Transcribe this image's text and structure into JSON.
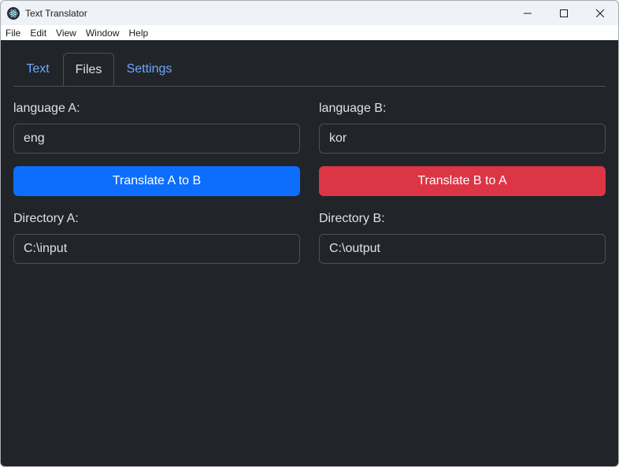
{
  "window": {
    "title": "Text Translator",
    "controls": {
      "minimize": "minimize-icon",
      "maximize": "maximize-icon",
      "close": "close-icon"
    }
  },
  "menu": {
    "items": [
      {
        "label": "File"
      },
      {
        "label": "Edit"
      },
      {
        "label": "View"
      },
      {
        "label": "Window"
      },
      {
        "label": "Help"
      }
    ]
  },
  "tabs": [
    {
      "label": "Text"
    },
    {
      "label": "Files",
      "active": true
    },
    {
      "label": "Settings"
    }
  ],
  "files": {
    "language_a_label": "language A:",
    "language_a_value": "eng",
    "language_b_label": "language B:",
    "language_b_value": "kor",
    "translate_a_to_b_label": "Translate A to B",
    "translate_b_to_a_label": "Translate B to A",
    "directory_a_label": "Directory A:",
    "directory_a_value": "C:\\input",
    "directory_b_label": "Directory B:",
    "directory_b_value": "C:\\output"
  },
  "colors": {
    "background": "#212529",
    "tab_link": "#6ea8fe",
    "primary_button": "#0d6efd",
    "danger_button": "#dc3545"
  }
}
